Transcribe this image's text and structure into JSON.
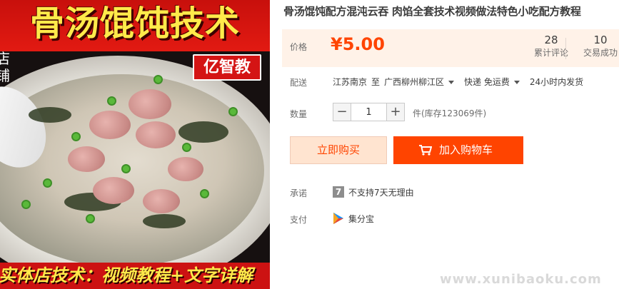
{
  "image": {
    "title": "骨汤馄饨技术",
    "badge": "亿智教",
    "bottom_text": "实体店技术：视频教程+文字详解",
    "side_chars": "店铺"
  },
  "product": {
    "title": "骨汤馄饨配方混沌云吞 肉馅全套技术视频做法特色小吃配方教程"
  },
  "price": {
    "label": "价格",
    "value": "¥5.00",
    "color": "#ff4400"
  },
  "stats": {
    "reviews_count": "28",
    "reviews_label": "累计评论",
    "sales_count": "10",
    "sales_label": "交易成功"
  },
  "delivery": {
    "label": "配送",
    "from": "江苏南京",
    "to_word": "至",
    "to": "广西柳州柳江区",
    "shipping": "快递 免运费",
    "dispatch": "24小时内发货"
  },
  "quantity": {
    "label": "数量",
    "minus": "−",
    "value": "1",
    "plus": "+",
    "stock": "件(库存123069件)"
  },
  "actions": {
    "buy_now": "立即购买",
    "add_to_cart": "加入购物车"
  },
  "promise": {
    "label": "承诺",
    "icon_text": "7",
    "text": "不支持7天无理由"
  },
  "payment": {
    "label": "支付",
    "text": "集分宝"
  },
  "watermark": "www.xunibaoku.com"
}
